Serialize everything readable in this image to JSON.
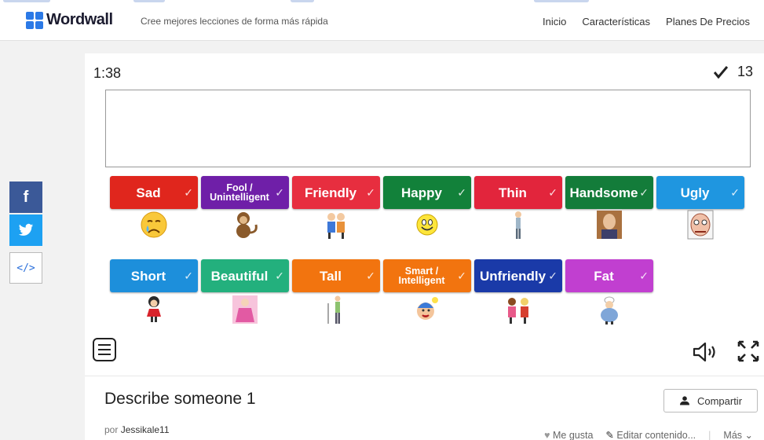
{
  "header": {
    "logo_text": "Wordwall",
    "tagline": "Cree mejores lecciones de forma más rápida",
    "nav": [
      "Inicio",
      "Características",
      "Planes De Precios"
    ]
  },
  "share_sidebar": {
    "facebook_glyph": "f",
    "embed_glyph": "</>"
  },
  "game": {
    "timer": "1:38",
    "score": "13",
    "words": [
      {
        "label": "Sad",
        "color": "#e0261d",
        "icon": "crying-face-icon"
      },
      {
        "label": "Fool / Unintelligent",
        "color": "#6f1fa8",
        "icon": "monkey-icon"
      },
      {
        "label": "Friendly",
        "color": "#e72e3f",
        "icon": "children-hugging-icon"
      },
      {
        "label": "Happy",
        "color": "#12813a",
        "icon": "smiley-face-icon"
      },
      {
        "label": "Thin",
        "color": "#e2253c",
        "icon": "thin-man-icon"
      },
      {
        "label": "Handsome",
        "color": "#137c3a",
        "icon": "handsome-man-icon"
      },
      {
        "label": "Ugly",
        "color": "#1f96e0",
        "icon": "ugly-face-icon"
      },
      {
        "label": "Short",
        "color": "#1d8fdb",
        "icon": "short-girl-icon"
      },
      {
        "label": "Beautiful",
        "color": "#23b07d",
        "icon": "princess-icon"
      },
      {
        "label": "Tall",
        "color": "#f2740f",
        "icon": "tall-person-icon"
      },
      {
        "label": "Smart / Intelligent",
        "color": "#f2740f",
        "icon": "smart-kid-icon"
      },
      {
        "label": "Unfriendly",
        "color": "#1a3aa8",
        "icon": "arguing-kids-icon"
      },
      {
        "label": "Fat",
        "color": "#c13fd0",
        "icon": "fat-chef-icon"
      }
    ]
  },
  "activity": {
    "title": "Describe someone 1",
    "share_label": "Compartir",
    "author_prefix": "por",
    "author": "Jessikale11",
    "like_label": "Me gusta",
    "edit_label": "Editar contenido...",
    "more_label": "Más"
  },
  "colors": {
    "page_bg": "#f2f2f2",
    "facebook": "#3b5998",
    "twitter": "#1da1f2"
  }
}
